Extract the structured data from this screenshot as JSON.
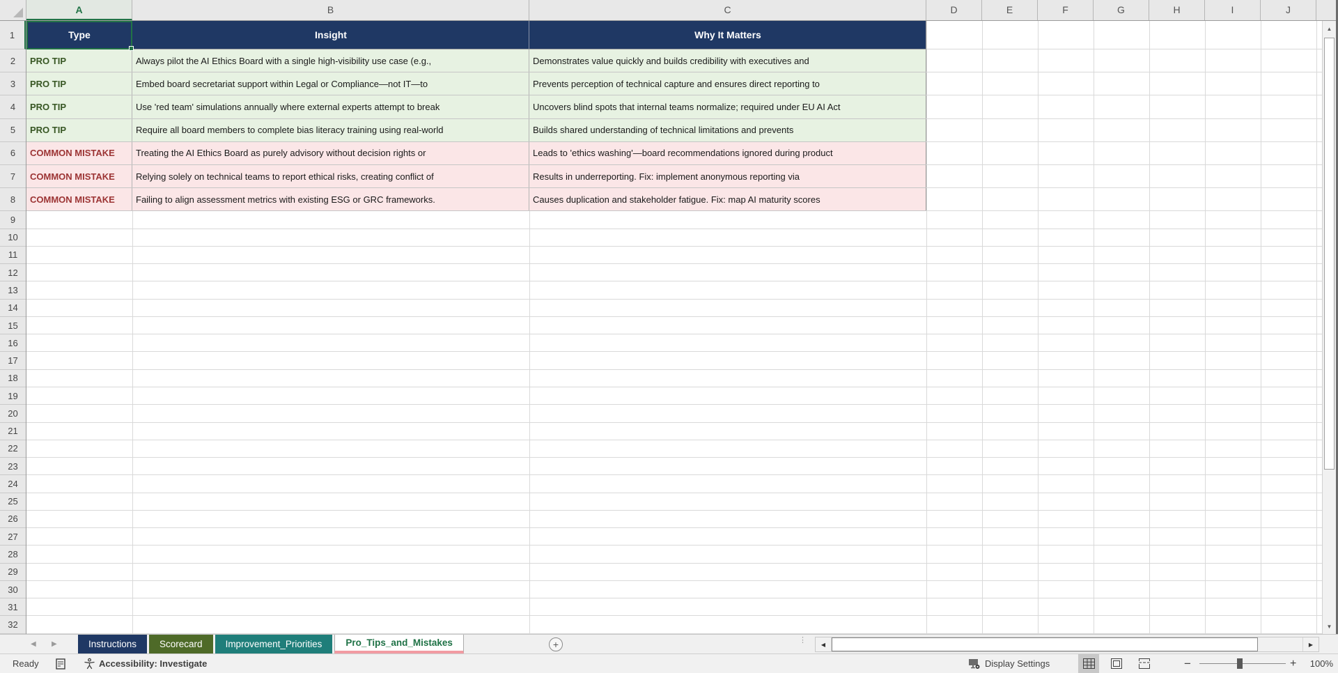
{
  "columns": [
    "A",
    "B",
    "C",
    "D",
    "E",
    "F",
    "G",
    "H",
    "I",
    "J"
  ],
  "rows_visible": 32,
  "selection": {
    "active_cell": "A1",
    "active_column": "A",
    "active_row": "1"
  },
  "table": {
    "headers": [
      "Type",
      "Insight",
      "Why It Matters"
    ],
    "rows": [
      {
        "type": "PRO TIP",
        "variant": "tip",
        "insight": "Always pilot the AI Ethics Board with a single high-visibility use case (e.g.,",
        "why": "Demonstrates value quickly and builds credibility with executives and"
      },
      {
        "type": "PRO TIP",
        "variant": "tip",
        "insight": "Embed board secretariat support within Legal or Compliance—not IT—to",
        "why": "Prevents perception of technical capture and ensures direct reporting to"
      },
      {
        "type": "PRO TIP",
        "variant": "tip",
        "insight": "Use 'red team' simulations annually where external experts attempt to break",
        "why": "Uncovers blind spots that internal teams normalize; required under EU AI Act"
      },
      {
        "type": "PRO TIP",
        "variant": "tip",
        "insight": "Require all board members to complete bias literacy training using real-world",
        "why": "Builds shared understanding of technical limitations and prevents"
      },
      {
        "type": "COMMON MISTAKE",
        "variant": "mistake",
        "insight": "Treating the AI Ethics Board as purely advisory without decision rights or",
        "why": "Leads to 'ethics washing'—board recommendations ignored during product"
      },
      {
        "type": "COMMON MISTAKE",
        "variant": "mistake",
        "insight": "Relying solely on technical teams to report ethical risks, creating conflict of",
        "why": "Results in underreporting. Fix: implement anonymous reporting via"
      },
      {
        "type": "COMMON MISTAKE",
        "variant": "mistake",
        "insight": "Failing to align assessment metrics with existing ESG or GRC frameworks.",
        "why": "Causes duplication and stakeholder fatigue. Fix: map AI maturity scores"
      }
    ]
  },
  "sheet_tabs": [
    {
      "label": "Instructions",
      "color": "#1F3864",
      "active": false
    },
    {
      "label": "Scorecard",
      "color": "#4E6A28",
      "active": false
    },
    {
      "label": "Improvement_Priorities",
      "color": "#1F7E7A",
      "active": false
    },
    {
      "label": "Pro_Tips_and_Mistakes",
      "color": "#F29BA2",
      "text_color": "#1E7145",
      "active": true
    }
  ],
  "tab_bar": {
    "add_sheet_label": "+"
  },
  "status_bar": {
    "ready": "Ready",
    "accessibility": "Accessibility: Investigate",
    "display_settings": "Display Settings",
    "zoom_out": "−",
    "zoom_in": "+",
    "zoom_level": "100%"
  },
  "colors": {
    "header_fill": "#1F3864",
    "header_text": "#FFFFFF",
    "tip_bg": "#E7F2E2",
    "tip_text": "#375623",
    "mistake_bg": "#FBE6E7",
    "mistake_text": "#9C3434",
    "selection_green": "#217346",
    "active_tab_accent": "#F29BA2"
  }
}
